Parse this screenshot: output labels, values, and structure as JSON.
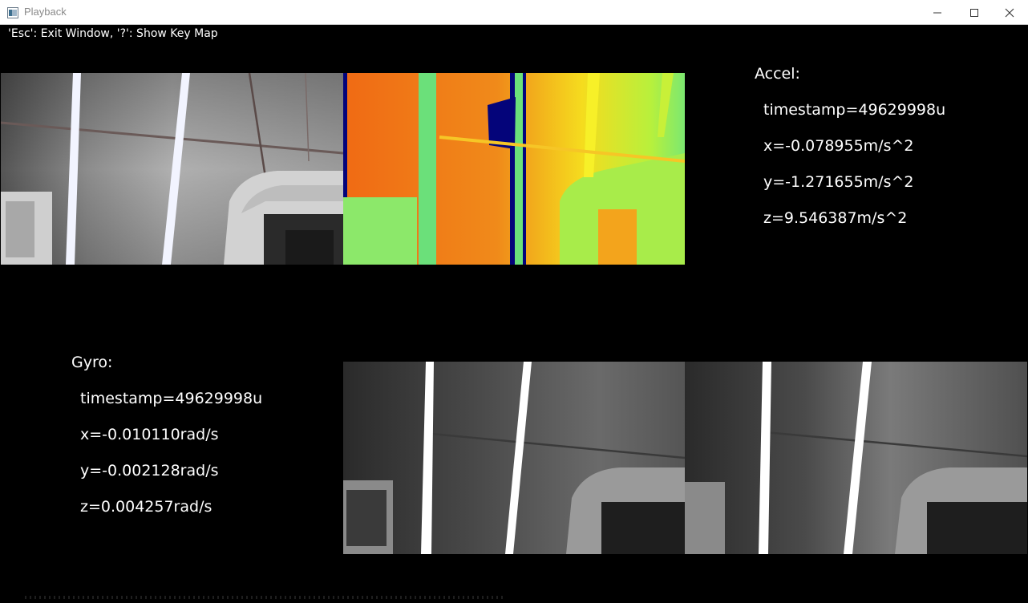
{
  "window": {
    "title": "Playback",
    "icon": "app-window-icon",
    "controls": {
      "minimize_icon": "minimize-icon",
      "maximize_icon": "maximize-icon",
      "close_icon": "close-icon"
    }
  },
  "hint": "'Esc': Exit Window, '?': Show Key Map",
  "streams": {
    "color": "color-stream-image",
    "depth": "depth-colormap-image",
    "left_ir": "left-infrared-image",
    "right_ir": "right-infrared-image"
  },
  "accel": {
    "heading": "Accel:",
    "timestamp": "timestamp=49629998u",
    "x": "x=-0.078955m/s^2",
    "y": "y=-1.271655m/s^2",
    "z": "z=9.546387m/s^2"
  },
  "gyro": {
    "heading": "Gyro:",
    "timestamp": "timestamp=49629998u",
    "x": "x=-0.010110rad/s",
    "y": "y=-0.002128rad/s",
    "z": "z=0.004257rad/s"
  },
  "colors": {
    "background": "#000000",
    "titlebar": "#ffffff",
    "text": "#ffffff",
    "depth_near": "#f06a14",
    "depth_mid": "#f5dc1e",
    "depth_far": "#6be07a",
    "depth_invalid": "#04047a"
  }
}
